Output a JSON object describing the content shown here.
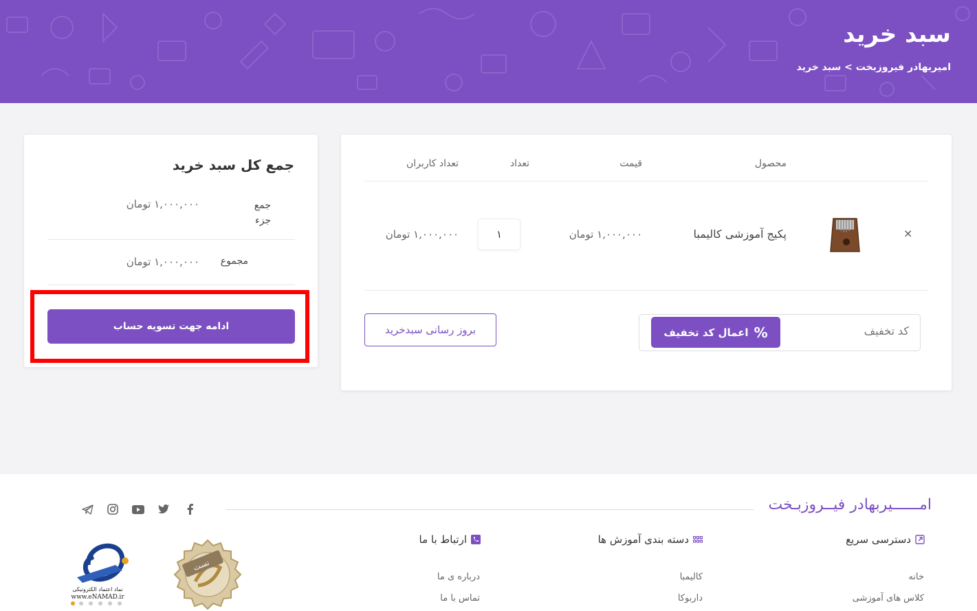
{
  "header": {
    "title": "سبد خرید",
    "breadcrumb": "امیربهادر فیروزبخت > سبد خرید"
  },
  "cart": {
    "columns": {
      "product": "محصول",
      "price": "قیمت",
      "quantity": "تعداد",
      "users": "تعداد کاربران"
    },
    "items": [
      {
        "remove": "×",
        "name": "پکیج آموزشی کالیمبا",
        "price": "۱,۰۰۰,۰۰۰ تومان",
        "quantity": "۱",
        "subtotal": "۱,۰۰۰,۰۰۰ تومان"
      }
    ],
    "coupon": {
      "placeholder": "کد تخفیف",
      "button": "اعمال کد تخفیف",
      "button_icon": "percent-icon"
    },
    "update_button": "بروز رسانی سبدخرید"
  },
  "totals": {
    "title": "جمع کل سبد خرید",
    "subtotal_label": "جمع جزء",
    "subtotal_value": "۱,۰۰۰,۰۰۰ تومان",
    "total_label": "مجموع",
    "total_value": "۱,۰۰۰,۰۰۰ تومان",
    "checkout_button": "ادامه جهت تسویه حساب"
  },
  "footer": {
    "brand": "امــــــیربهادر فیــروزبـخت",
    "social_icons": [
      "facebook-icon",
      "twitter-icon",
      "youtube-icon",
      "instagram-icon",
      "telegram-icon"
    ],
    "quick_access": {
      "title": "دسترسی سریع",
      "links": [
        "خانه",
        "کلاس های آموزشی"
      ]
    },
    "categories": {
      "title": "دسته بندی آموزش ها",
      "links": [
        "کالیمبا",
        "داربوکا"
      ]
    },
    "contact": {
      "title": "ارتباط با ما",
      "links": [
        "درباره ی ما",
        "تماس با ما"
      ]
    },
    "enamad_text": "نماد اعتماد الکترونیکی",
    "enamad_url": "www.eNAMAD.ir",
    "seal_text": "نست"
  },
  "colors": {
    "primary": "#7c4fc2",
    "highlight": "#ff0000",
    "background": "#f3f3f5"
  }
}
